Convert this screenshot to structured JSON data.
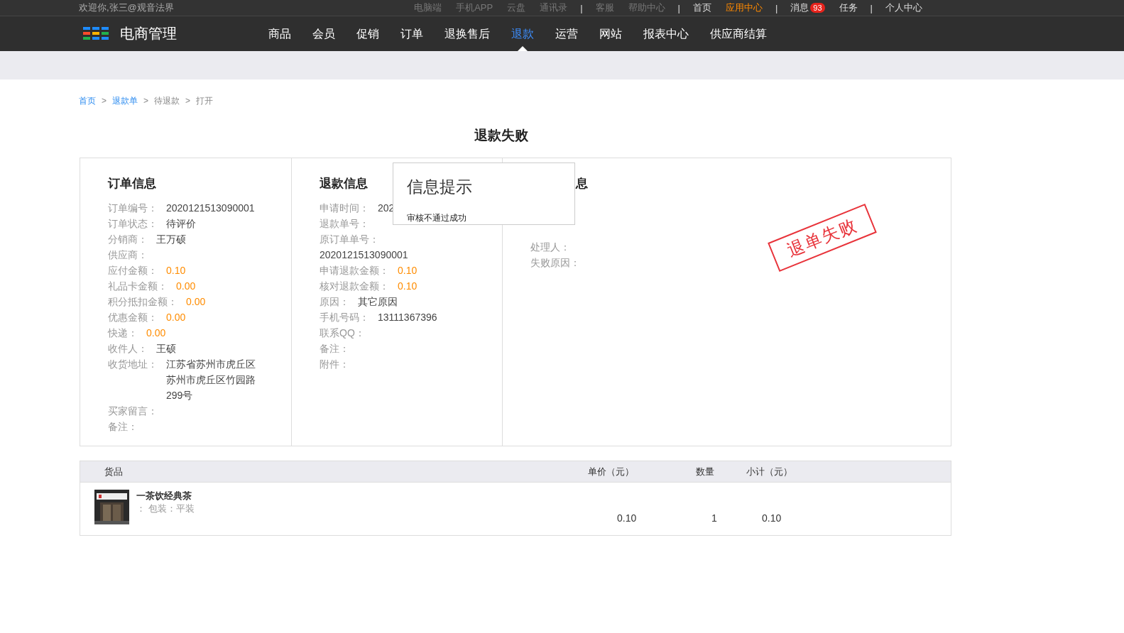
{
  "top_bar": {
    "welcome": "欢迎你,张三@观音法界",
    "links": [
      {
        "kind": "link",
        "label": "电脑端",
        "dim": true,
        "highlighted": false
      },
      {
        "kind": "link",
        "label": "手机APP",
        "dim": true,
        "highlighted": false
      },
      {
        "kind": "link",
        "label": "云盘",
        "dim": true,
        "highlighted": false
      },
      {
        "kind": "link",
        "label": "通讯录",
        "dim": true,
        "highlighted": false
      },
      {
        "kind": "sep",
        "label": "|"
      },
      {
        "kind": "link",
        "label": "客服",
        "dim": true,
        "highlighted": false
      },
      {
        "kind": "link",
        "label": "帮助中心",
        "dim": true,
        "highlighted": false
      },
      {
        "kind": "sep",
        "label": "|"
      },
      {
        "kind": "link",
        "label": "首页",
        "dim": false,
        "highlighted": false
      },
      {
        "kind": "link",
        "label": "应用中心",
        "dim": false,
        "highlighted": true
      },
      {
        "kind": "sep",
        "label": "|"
      },
      {
        "kind": "link",
        "label": "消息",
        "dim": false,
        "highlighted": false,
        "badge": "93"
      },
      {
        "kind": "link",
        "label": "任务",
        "dim": false,
        "highlighted": false
      },
      {
        "kind": "sep",
        "label": "|"
      },
      {
        "kind": "link",
        "label": "个人中心",
        "dim": false,
        "highlighted": false
      }
    ]
  },
  "nav": {
    "logo": "电商管理",
    "items": [
      {
        "label": "商品",
        "selected": false
      },
      {
        "label": "会员",
        "selected": false
      },
      {
        "label": "促销",
        "selected": false
      },
      {
        "label": "订单",
        "selected": false
      },
      {
        "label": "退换售后",
        "selected": false
      },
      {
        "label": "退款",
        "selected": true
      },
      {
        "label": "运营",
        "selected": false
      },
      {
        "label": "网站",
        "selected": false
      },
      {
        "label": "报表中心",
        "selected": false
      },
      {
        "label": "供应商结算",
        "selected": false
      }
    ]
  },
  "breadcrumb": [
    {
      "label": "首页",
      "link": true
    },
    {
      "label": ">",
      "link": false
    },
    {
      "label": "退款单",
      "link": true
    },
    {
      "label": ">",
      "link": false
    },
    {
      "label": "待退款",
      "link": false
    },
    {
      "label": ">",
      "link": false
    },
    {
      "label": "打开",
      "link": false
    }
  ],
  "page_title": "退款失败",
  "panels": [
    {
      "title": "订单信息",
      "rows": [
        {
          "label": "订单编号：",
          "value": "2020121513090001",
          "kind": "text"
        },
        {
          "label": "订单状态：",
          "value": "待评价",
          "kind": "text"
        },
        {
          "label": "分销商：",
          "value": "王万硕",
          "kind": "text"
        },
        {
          "label": "供应商：",
          "kind": "text"
        },
        {
          "label": "应付金额：",
          "value": "0.10",
          "kind": "amount"
        },
        {
          "label": "礼品卡金额：",
          "value": "0.00",
          "kind": "amount"
        },
        {
          "label": "积分抵扣金额：",
          "value": "0.00",
          "kind": "amount"
        },
        {
          "label": "优惠金额：",
          "value": "0.00",
          "kind": "amount"
        },
        {
          "label": "快递：",
          "value": "0.00",
          "kind": "amount"
        },
        {
          "label": "收件人：",
          "value": "王硕",
          "kind": "text"
        },
        {
          "label": "收货地址：",
          "value": "江苏省苏州市虎丘区苏州市虎丘区竹园路299号",
          "kind": "text"
        },
        {
          "label": "买家留言：",
          "kind": "text"
        },
        {
          "label": "备注：",
          "kind": "text"
        }
      ]
    },
    {
      "title": "退款信息",
      "rows": [
        {
          "label": "申请时间：",
          "value": "202",
          "kind": "text"
        },
        {
          "label": "退款单号：",
          "kind": "text"
        },
        {
          "label": "原订单单号：",
          "value": "2020121513090001",
          "kind": "stacked"
        },
        {
          "label": "申请退款金额：",
          "value": "0.10",
          "kind": "amount"
        },
        {
          "label": "核对退款金额：",
          "value": "0.10",
          "kind": "amount"
        },
        {
          "label": "原因：",
          "value": "其它原因",
          "kind": "text"
        },
        {
          "label": "手机号码：",
          "value": "13111367396",
          "kind": "text"
        },
        {
          "label": "联系QQ：",
          "kind": "text"
        },
        {
          "label": "备注：",
          "kind": "text"
        },
        {
          "label": "附件：",
          "kind": "text"
        }
      ]
    },
    {
      "title": "息",
      "rows": [
        {
          "label": "处理人：",
          "kind": "text"
        },
        {
          "label": "失败原因：",
          "kind": "text"
        }
      ],
      "stamp": "退单失败"
    }
  ],
  "goods": {
    "columns": [
      "货品",
      "单价（元）",
      "数量",
      "小计（元）"
    ],
    "rows": [
      {
        "kind": "picture",
        "name": "一茶饮经典茶",
        "spec": "：  包装：平装",
        "price": "0.10",
        "qty": "1",
        "subtotal": "0.10"
      }
    ]
  },
  "dialog": {
    "title": "信息提示",
    "message": "审核不通过成功"
  }
}
